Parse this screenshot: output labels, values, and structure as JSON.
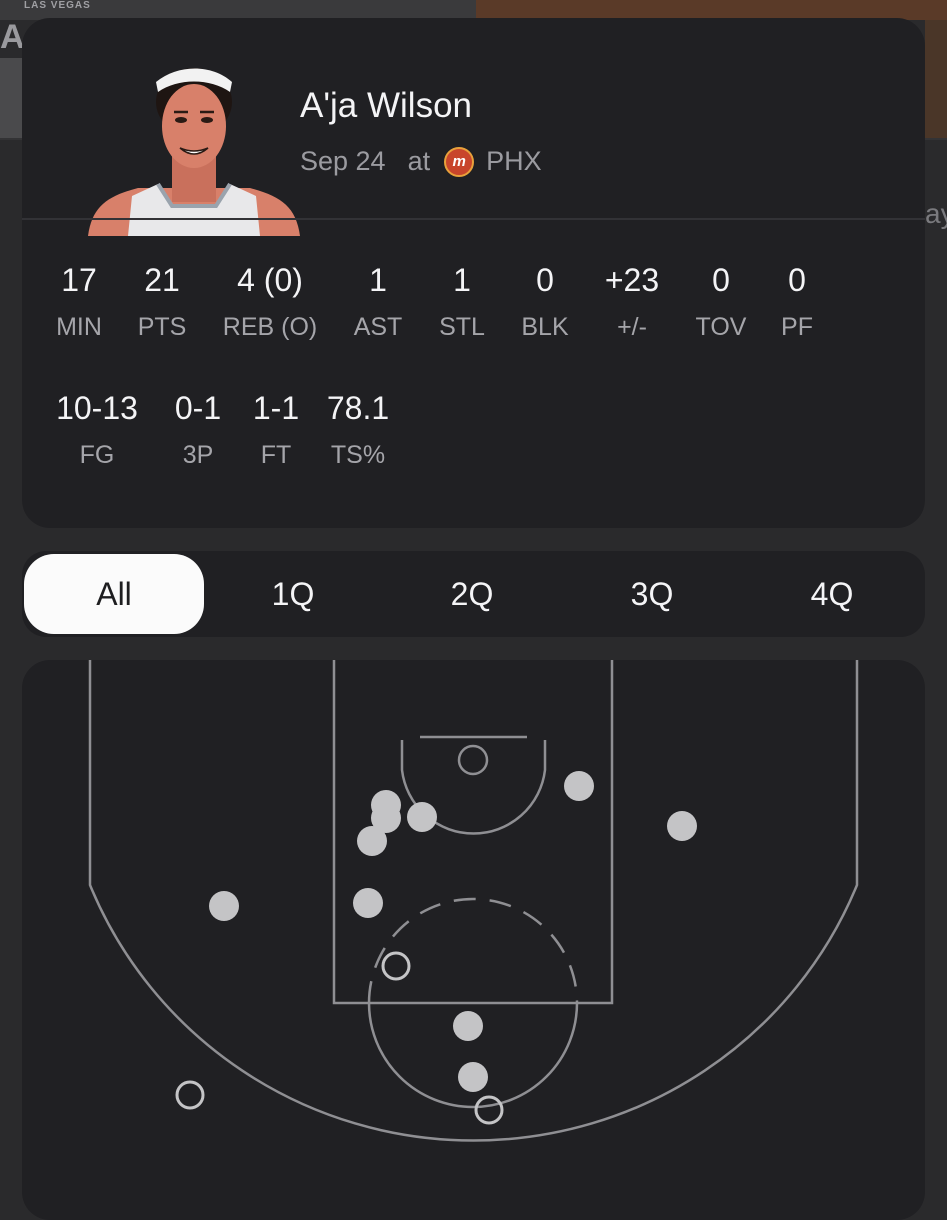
{
  "background": {
    "left_logo_small": "LAS VEGAS",
    "left_logo_large": "AC",
    "right_partial_text": "ay"
  },
  "player": {
    "name": "A'ja Wilson",
    "date": "Sep 24",
    "location_prefix": "at",
    "opponent": "PHX",
    "opponent_logo_letter": "m",
    "avatar_icon": "player-avatar-illustration"
  },
  "stats_row1": [
    {
      "value": "17",
      "label": "MIN"
    },
    {
      "value": "21",
      "label": "PTS"
    },
    {
      "value": "4 (0)",
      "label": "REB (O)"
    },
    {
      "value": "1",
      "label": "AST"
    },
    {
      "value": "1",
      "label": "STL"
    },
    {
      "value": "0",
      "label": "BLK"
    },
    {
      "value": "+23",
      "label": "+/-"
    },
    {
      "value": "0",
      "label": "TOV"
    },
    {
      "value": "0",
      "label": "PF"
    }
  ],
  "stats_row2": [
    {
      "value": "10-13",
      "label": "FG"
    },
    {
      "value": "0-1",
      "label": "3P"
    },
    {
      "value": "1-1",
      "label": "FT"
    },
    {
      "value": "78.1",
      "label": "TS%"
    }
  ],
  "tabs": [
    {
      "label": "All",
      "active": true
    },
    {
      "label": "1Q",
      "active": false
    },
    {
      "label": "2Q",
      "active": false
    },
    {
      "label": "3Q",
      "active": false
    },
    {
      "label": "4Q",
      "active": false
    }
  ],
  "colors": {
    "card_bg": "#202023",
    "made_shot": "#c4c4c6",
    "missed_shot": "#c4c4c6",
    "court_lines": "#8f8f93",
    "team_logo": "#c8452b"
  },
  "shots": [
    {
      "made": true
    },
    {
      "made": true
    },
    {
      "made": true
    },
    {
      "made": true
    },
    {
      "made": true
    },
    {
      "made": true
    },
    {
      "made": true
    },
    {
      "made": true
    },
    {
      "made": true
    },
    {
      "made": true
    },
    {
      "made": false
    },
    {
      "made": false
    },
    {
      "made": false
    }
  ]
}
